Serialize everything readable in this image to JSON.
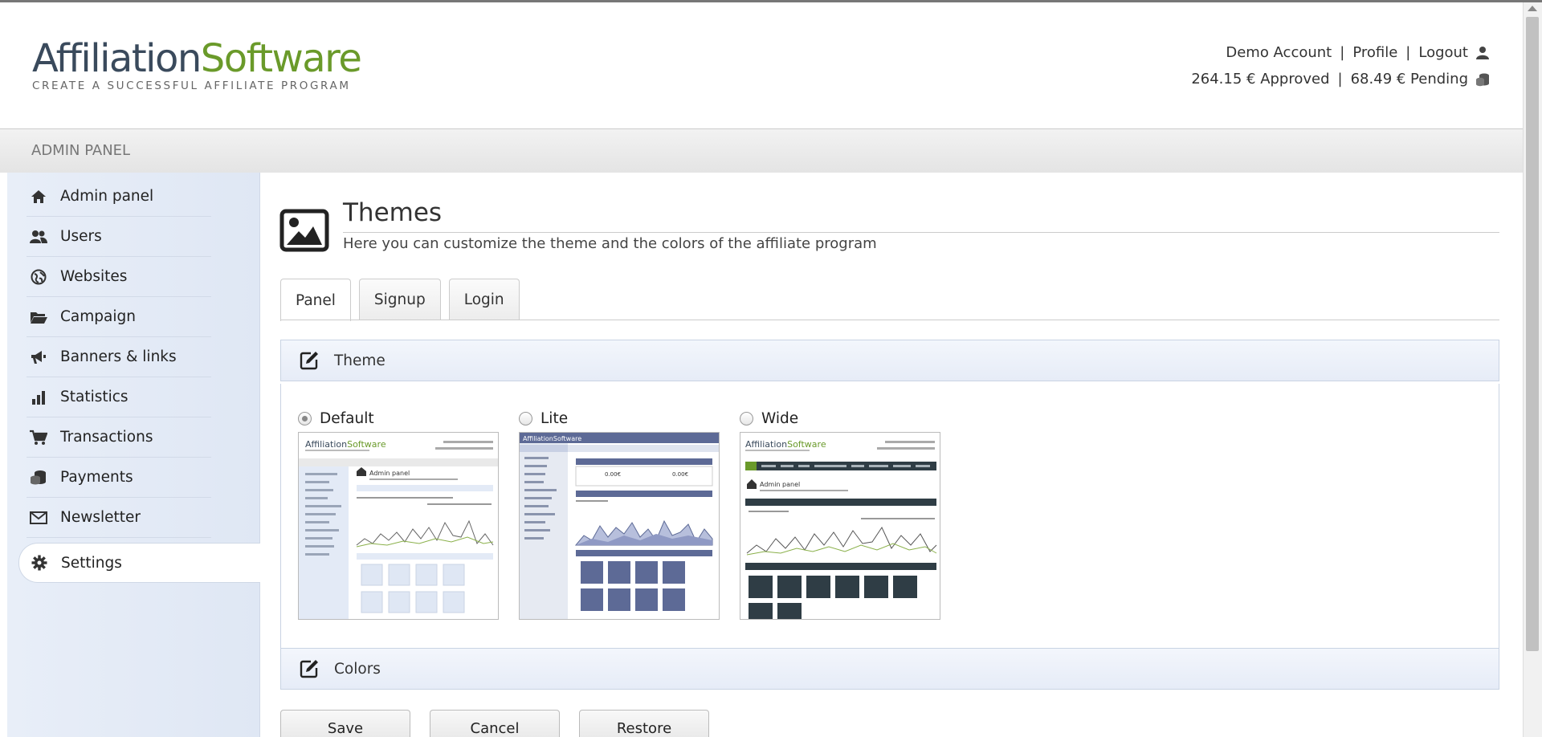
{
  "header": {
    "logo_part1": "Affiliation",
    "logo_part2": "Software",
    "logo_tagline": "CREATE A SUCCESSFUL AFFILIATE PROGRAM",
    "account_name": "Demo Account",
    "profile_link": "Profile",
    "logout_link": "Logout",
    "approved": "264.15 € Approved",
    "pending": "68.49 € Pending",
    "separator": "|"
  },
  "adminbar": {
    "label": "ADMIN PANEL"
  },
  "sidebar": {
    "items": [
      {
        "label": "Admin panel",
        "icon": "home-icon"
      },
      {
        "label": "Users",
        "icon": "users-icon"
      },
      {
        "label": "Websites",
        "icon": "globe-icon"
      },
      {
        "label": "Campaign",
        "icon": "folder-icon"
      },
      {
        "label": "Banners & links",
        "icon": "megaphone-icon"
      },
      {
        "label": "Statistics",
        "icon": "bar-chart-icon"
      },
      {
        "label": "Transactions",
        "icon": "cart-icon"
      },
      {
        "label": "Payments",
        "icon": "coins-icon"
      },
      {
        "label": "Newsletter",
        "icon": "mail-icon"
      },
      {
        "label": "Settings",
        "icon": "gear-icon",
        "active": true
      }
    ]
  },
  "main": {
    "title": "Themes",
    "subtitle": "Here you can customize the theme and the colors of the affiliate program",
    "tabs": [
      {
        "label": "Panel",
        "active": true
      },
      {
        "label": "Signup"
      },
      {
        "label": "Login"
      }
    ],
    "theme_section": "Theme",
    "colors_section": "Colors",
    "themes": [
      {
        "name": "Default",
        "selected": true
      },
      {
        "name": "Lite",
        "selected": false
      },
      {
        "name": "Wide",
        "selected": false
      }
    ],
    "buttons": {
      "save": "Save",
      "cancel": "Cancel",
      "restore": "Restore"
    }
  },
  "colors": {
    "sidebar_bg": "#e3eaf6",
    "logo_dark": "#3a4a5c",
    "logo_green": "#6a9a2a",
    "lite_header": "#5d6a96",
    "wide_nav": "#2f3d45"
  }
}
